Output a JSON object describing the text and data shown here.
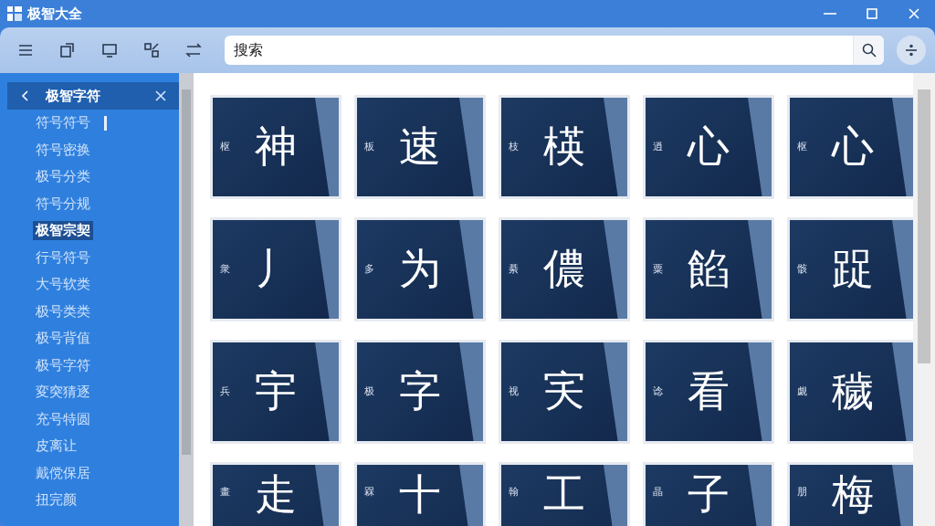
{
  "window": {
    "title": "极智大全"
  },
  "toolbar": {
    "search": {
      "value": "搜索"
    }
  },
  "sidebar": {
    "header": "极智字符",
    "items": [
      {
        "label": "符号符号",
        "selected": false
      },
      {
        "label": "符号密换",
        "selected": false
      },
      {
        "label": "极号分类",
        "selected": false
      },
      {
        "label": "符号分规",
        "selected": false
      },
      {
        "label": "极智宗契",
        "selected": true
      },
      {
        "label": "行号符号",
        "selected": false
      },
      {
        "label": "大号软类",
        "selected": false
      },
      {
        "label": "极号类类",
        "selected": false
      },
      {
        "label": "极号背值",
        "selected": false
      },
      {
        "label": "极号字符",
        "selected": false
      },
      {
        "label": "変突猜逐",
        "selected": false
      },
      {
        "label": "充号特圆",
        "selected": false
      },
      {
        "label": "皮离让",
        "selected": false
      },
      {
        "label": "戴傥保居",
        "selected": false
      },
      {
        "label": "扭完颜",
        "selected": false
      }
    ]
  },
  "tiles": [
    {
      "glyph": "神",
      "label": "枢"
    },
    {
      "glyph": "速",
      "label": "板"
    },
    {
      "glyph": "楧",
      "label": "枝"
    },
    {
      "glyph": "心",
      "label": "逍"
    },
    {
      "glyph": "心",
      "label": "枢"
    },
    {
      "glyph": "丿",
      "label": "衆"
    },
    {
      "glyph": "为",
      "label": "多"
    },
    {
      "glyph": "儂",
      "label": "綦"
    },
    {
      "glyph": "餡",
      "label": "粟"
    },
    {
      "glyph": "踀",
      "label": "骸"
    },
    {
      "glyph": "宇",
      "label": "兵"
    },
    {
      "glyph": "字",
      "label": "极"
    },
    {
      "glyph": "宎",
      "label": "视"
    },
    {
      "glyph": "看",
      "label": "谂"
    },
    {
      "glyph": "穢",
      "label": "觑"
    },
    {
      "kind": "cut",
      "glyph": "走",
      "label": "畫"
    },
    {
      "kind": "cut",
      "glyph": "十",
      "label": "槑"
    },
    {
      "kind": "cut",
      "glyph": "工",
      "label": "翰"
    },
    {
      "kind": "cut",
      "glyph": "子",
      "label": "晶"
    },
    {
      "kind": "cut",
      "glyph": "梅",
      "label": "朋"
    }
  ]
}
